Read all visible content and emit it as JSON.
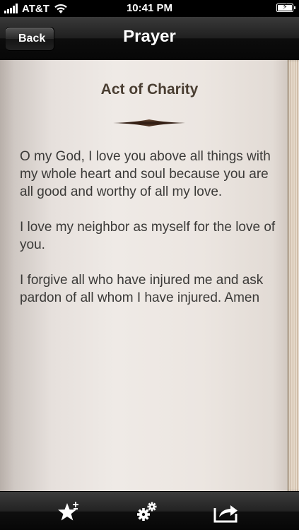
{
  "status_bar": {
    "carrier": "AT&T",
    "time": "10:41 PM",
    "battery_level": 1.0
  },
  "nav": {
    "back_label": "Back",
    "title": "Prayer"
  },
  "prayer": {
    "title": "Act of Charity",
    "paragraphs": [
      "O my God, I love you above all things with my whole heart and soul because you are all good and worthy of all my love.",
      "I love my neighbor as myself for the love of you.",
      "I forgive all who have injured me and ask pardon of all whom I have injured. Amen"
    ]
  },
  "toolbar": {
    "items": [
      {
        "icon": "star-add-icon"
      },
      {
        "icon": "gears-icon"
      },
      {
        "icon": "share-icon"
      }
    ]
  },
  "colors": {
    "title_text": "#4a3e32",
    "body_text": "#3b3a38",
    "page": "#ece6e1"
  }
}
